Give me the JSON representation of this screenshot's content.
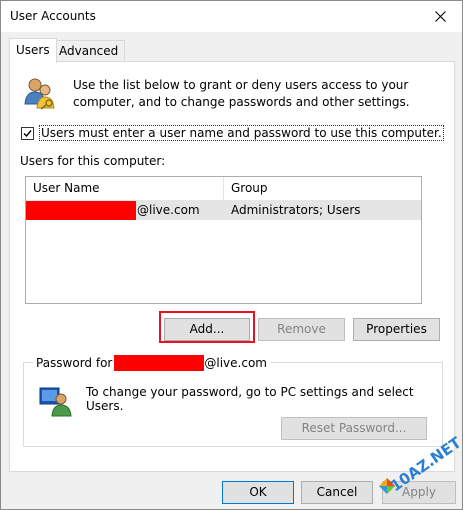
{
  "window": {
    "title": "User Accounts"
  },
  "tabs": [
    {
      "label": "Users",
      "active": true
    },
    {
      "label": "Advanced",
      "active": false
    }
  ],
  "users_tab": {
    "intro_text": "Use the list below to grant or deny users access to your computer, and to change passwords and other settings.",
    "checkbox_label": "Users must enter a user name and password to use this computer.",
    "checkbox_checked": true,
    "users_label": "Users for this computer:",
    "table": {
      "columns": [
        "User Name",
        "Group"
      ],
      "rows": [
        {
          "user_suffix": "@live.com",
          "group": "Administrators; Users",
          "selected": true
        }
      ]
    },
    "buttons": {
      "add": "Add...",
      "remove": "Remove",
      "properties": "Properties"
    },
    "password_group": {
      "legend_prefix": "Password for",
      "legend_suffix": "@live.com",
      "text": "To change your password, go to PC settings and select Users.",
      "reset_button": "Reset Password..."
    }
  },
  "dialog_buttons": {
    "ok": "OK",
    "cancel": "Cancel",
    "apply": "Apply"
  },
  "watermark": {
    "text": "10AZ.NET"
  },
  "colors": {
    "redaction": "#ff0000",
    "highlight": "#e81123",
    "accent": "#0078d7"
  },
  "icons": [
    "users-icon",
    "user-key-icon",
    "close-icon",
    "check-icon"
  ]
}
